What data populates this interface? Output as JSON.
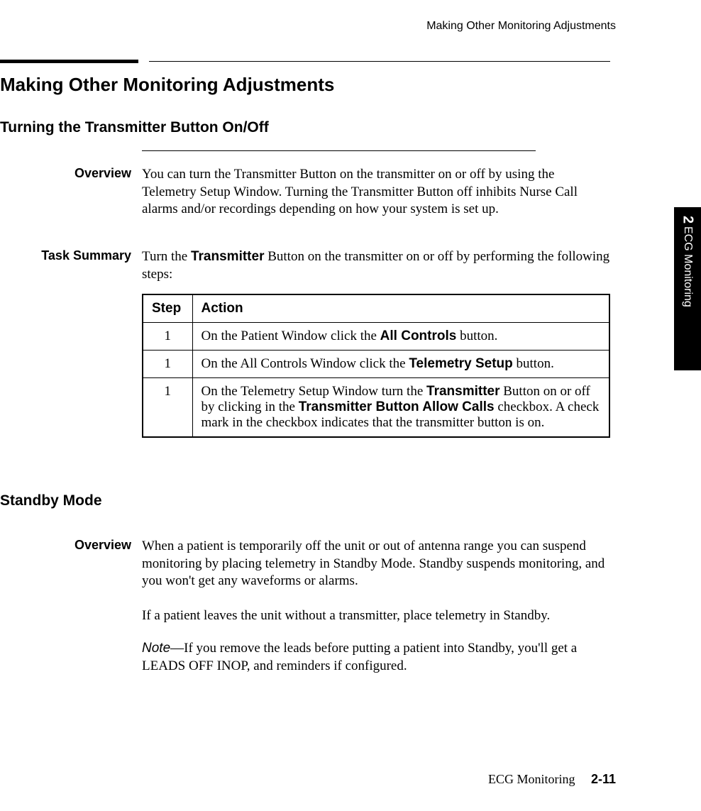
{
  "header": {
    "running": "Making Other Monitoring Adjustments"
  },
  "h1": "Making Other Monitoring Adjustments",
  "section1": {
    "title": "Turning the Transmitter Button On/Off",
    "overview_label": "Overview",
    "overview_body": "You can turn the Transmitter Button on the transmitter on or off by using the Telemetry Setup Window. Turning the Transmitter Button off inhibits Nurse Call alarms and/or recordings depending on how your system is set up.",
    "task_label": "Task Summary",
    "task_body_pre": "Turn the ",
    "task_body_bold": "Transmitter",
    "task_body_post": " Button on the transmitter on or off by performing the following steps:",
    "table": {
      "head_step": "Step",
      "head_action": "Action",
      "rows": [
        {
          "step": "1",
          "pre": "On the Patient Window click the ",
          "b1": "All Controls",
          "post": " button."
        },
        {
          "step": "1",
          "pre": "On the All Controls Window click the ",
          "b1": "Telemetry Setup",
          "post": " button."
        },
        {
          "step": "1",
          "pre": "On the Telemetry Setup Window turn the ",
          "b1": "Transmitter",
          "mid": " Button on or off by clicking in the ",
          "b2": "Transmitter Button Allow Calls",
          "post": " checkbox. A check mark in the checkbox indicates that the transmitter button is on."
        }
      ]
    }
  },
  "section2": {
    "title": "Standby Mode",
    "overview_label": "Overview",
    "overview_body": "When a patient is temporarily off the unit or out of antenna range you can suspend monitoring by placing telemetry in Standby Mode. Standby suspends monitoring, and you won't get any waveforms or alarms.",
    "p2": "If a patient leaves the unit without a transmitter, place telemetry in Standby.",
    "note_label": "Note",
    "note_dash": "—",
    "note_body": "If you remove the leads before putting a patient into Standby, you'll get a LEADS OFF INOP, and reminders if configured."
  },
  "side_tab": {
    "chapter_num": "2",
    "chapter_title": "ECG Monitoring"
  },
  "footer": {
    "title": "ECG Monitoring",
    "page": "2-11"
  }
}
